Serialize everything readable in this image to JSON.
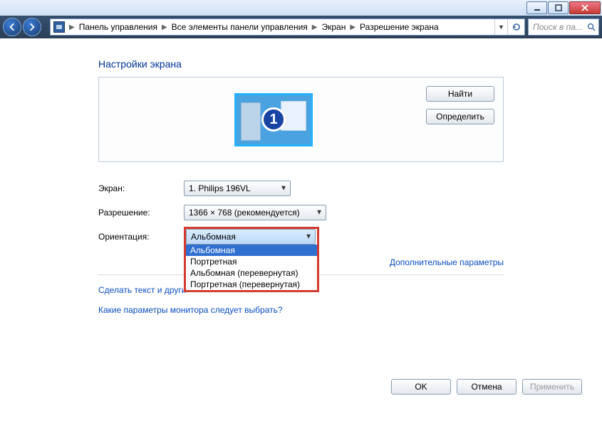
{
  "window": {
    "minimize_icon": "minimize",
    "maximize_icon": "maximize",
    "close_icon": "close"
  },
  "breadcrumb": {
    "items": [
      "Панель управления",
      "Все элементы панели управления",
      "Экран",
      "Разрешение экрана"
    ]
  },
  "search": {
    "placeholder": "Поиск в па..."
  },
  "page": {
    "heading": "Настройки экрана",
    "find_btn": "Найти",
    "identify_btn": "Определить",
    "display_number": "1"
  },
  "form": {
    "display_label": "Экран:",
    "display_value": "1. Philips 196VL",
    "resolution_label": "Разрешение:",
    "resolution_value": "1366 × 768 (рекомендуется)",
    "orientation_label": "Ориентация:",
    "orientation_value": "Альбомная",
    "orientation_options": [
      "Альбомная",
      "Портретная",
      "Альбомная (перевернутая)",
      "Портретная (перевернутая)"
    ]
  },
  "links": {
    "advanced": "Дополнительные параметры",
    "text_size": "Сделать текст и други",
    "help": "Какие параметры монитора следует выбрать?"
  },
  "buttons": {
    "ok": "OK",
    "cancel": "Отмена",
    "apply": "Применить"
  }
}
